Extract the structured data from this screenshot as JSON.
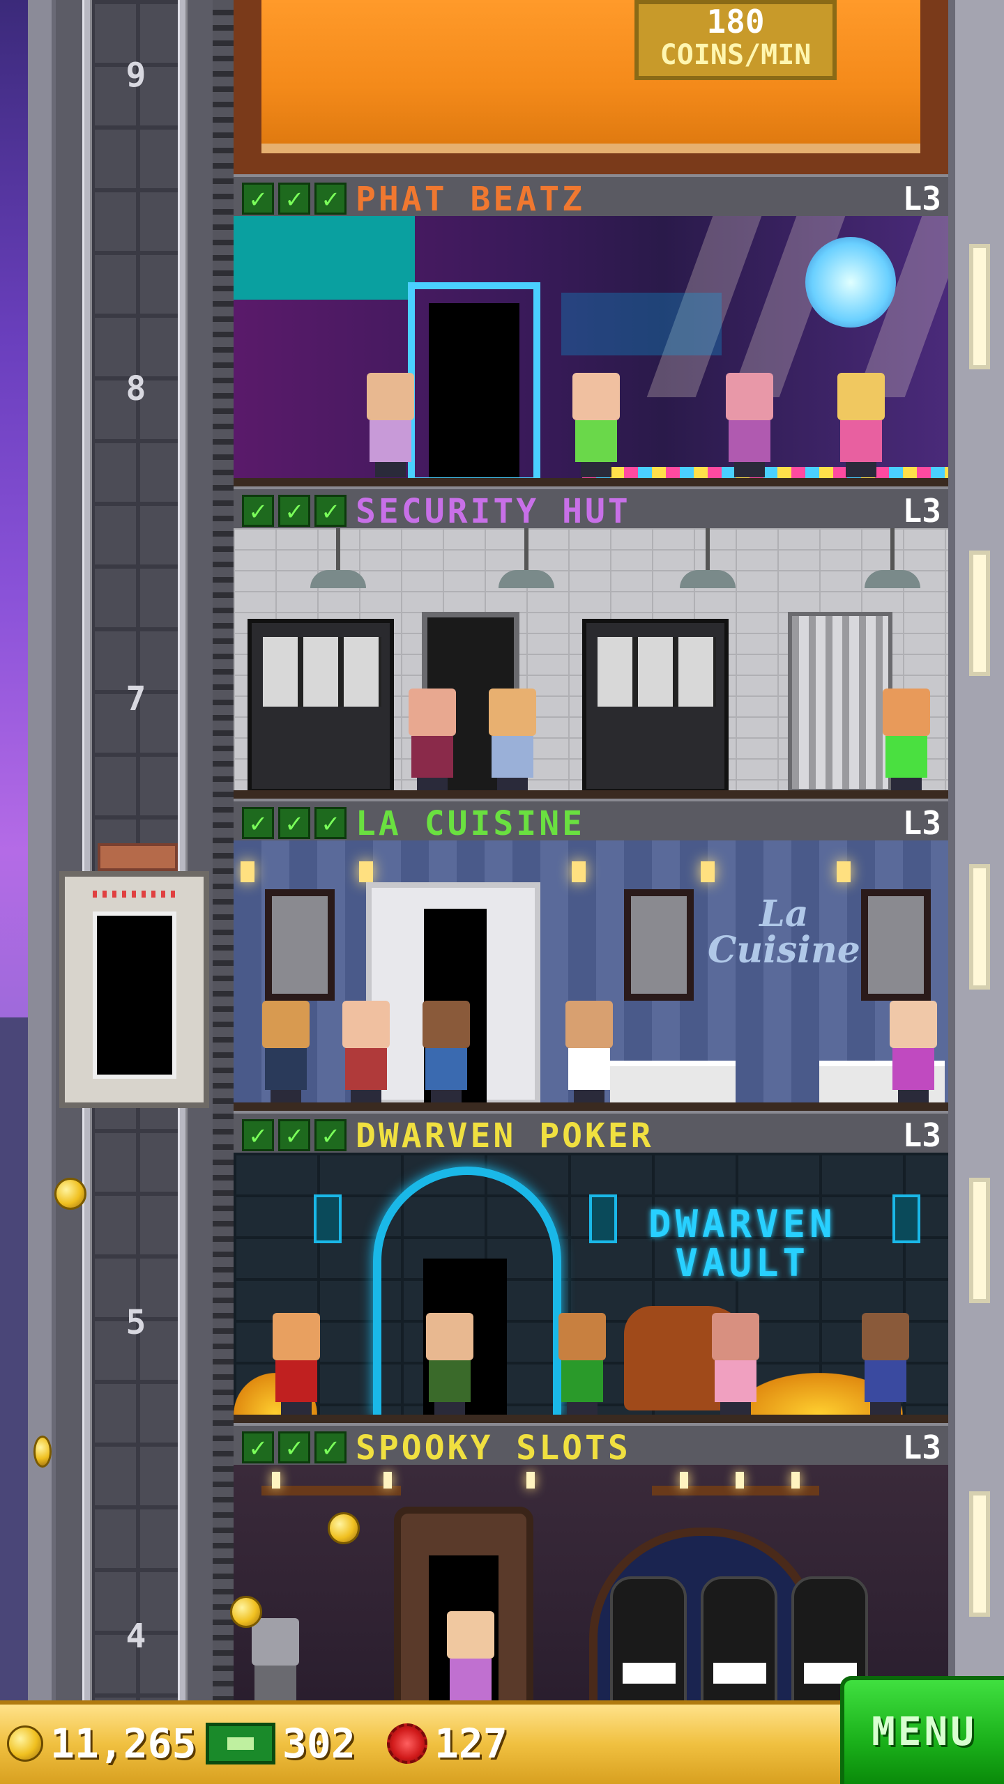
{
  "top_floor": {
    "income_value": "180",
    "income_unit": "COINS/MIN"
  },
  "shaft": {
    "floor_numbers": [
      "9",
      "8",
      "7",
      "5",
      "4"
    ]
  },
  "floors": [
    {
      "name": "PHAT BEATZ",
      "level": "L3",
      "name_color": "#f07830",
      "checks": 3
    },
    {
      "name": "SECURITY HUT",
      "level": "L3",
      "name_color": "#c870e8",
      "checks": 3
    },
    {
      "name": "LA CUISINE",
      "level": "L3",
      "name_color": "#6ae040",
      "checks": 3
    },
    {
      "name": "DWARVEN POKER",
      "level": "L3",
      "name_color": "#f0e040",
      "checks": 3
    },
    {
      "name": "SPOOKY SLOTS",
      "level": "L3",
      "name_color": "#f0e040",
      "checks": 3
    }
  ],
  "signs": {
    "la_cuisine_line1": "La",
    "la_cuisine_line2": "Cuisine",
    "dwarven_vault_line1": "DWARVEN",
    "dwarven_vault_line2": "VAULT"
  },
  "status_bar": {
    "coins": "11,265",
    "bux": "302",
    "gems": "127",
    "menu_label": "MENU"
  },
  "icons": {
    "check": "check-icon",
    "coin": "coin-icon",
    "bux": "tower-bux-icon",
    "gem": "gem-icon"
  },
  "colors": {
    "check_green": "#7aff5a",
    "menu_green": "#1ab01a",
    "bar_gold": "#f0c040"
  }
}
